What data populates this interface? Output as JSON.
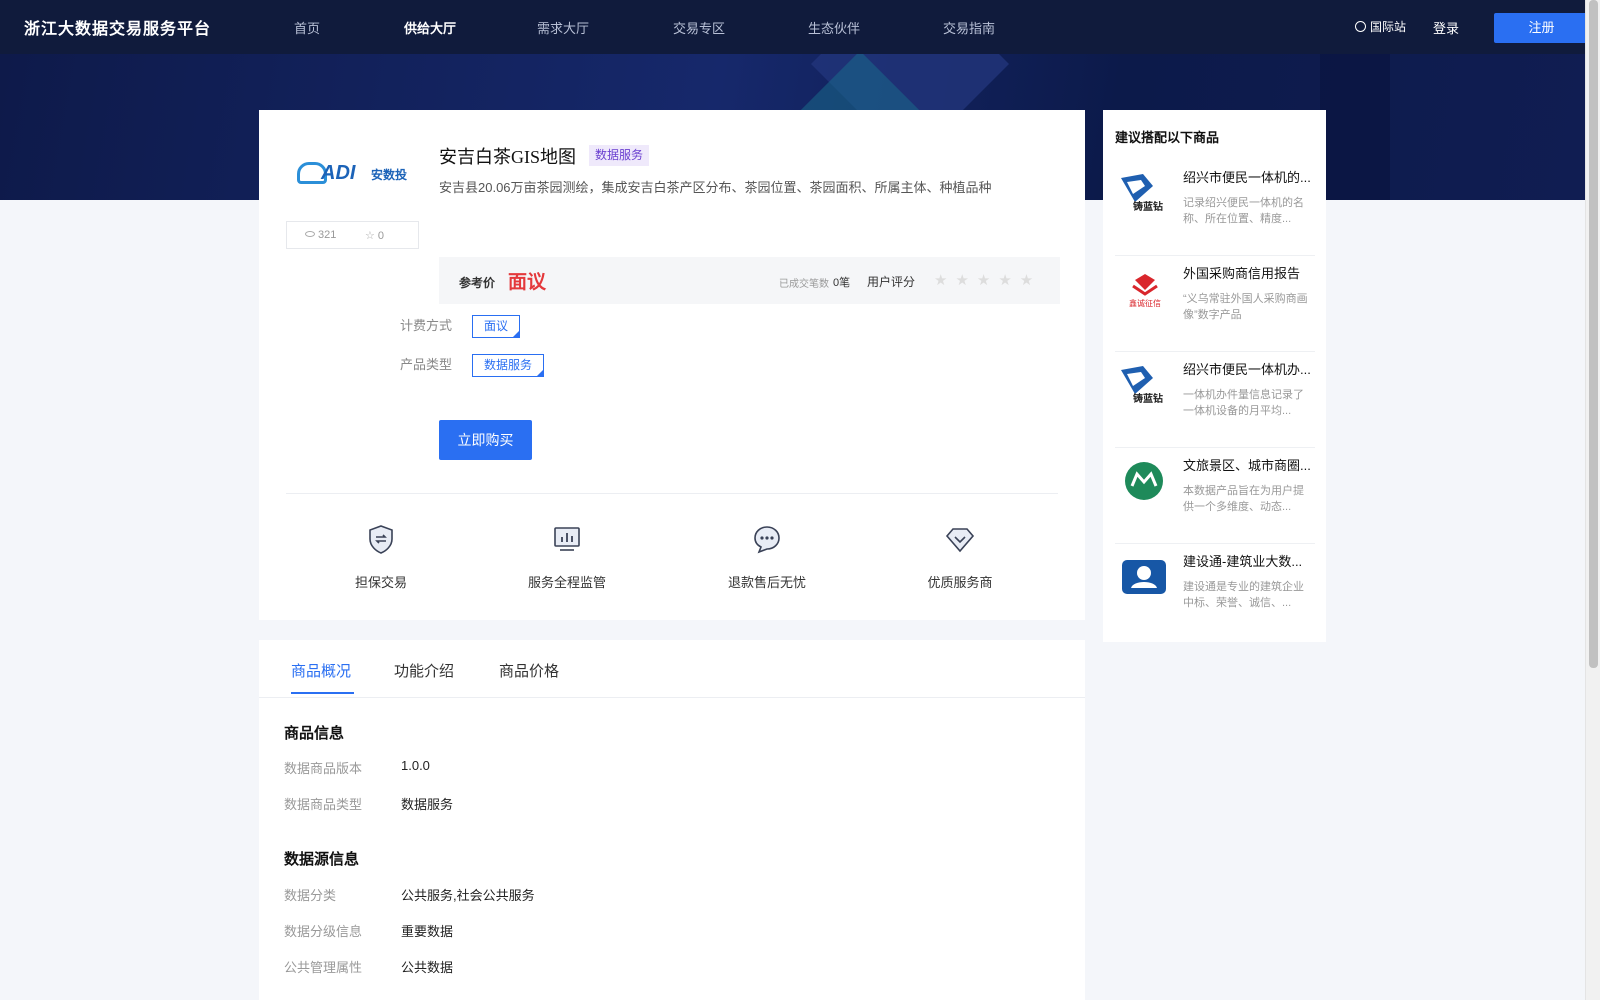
{
  "nav": {
    "brand": "浙江大数据交易服务平台",
    "links": [
      "首页",
      "供给大厅",
      "需求大厅",
      "交易专区",
      "生态伙伴",
      "交易指南"
    ],
    "intl": "国际站",
    "login": "登录",
    "register": "注册"
  },
  "product": {
    "logo_text": "ADI",
    "logo_cn": "安数投",
    "views": "321",
    "favorites": "0",
    "title": "安吉白茶GIS地图",
    "tag": "数据服务",
    "description": "安吉县20.06万亩茶园测绘，集成安吉白茶产区分布、茶园位置、茶园面积、所属主体、种植品种",
    "price_label": "参考价",
    "price_value": "面议",
    "deals_label": "已成交笔数",
    "deals_value": "0笔",
    "rating_label": "用户评分",
    "stars": "★★★★★",
    "billing_label": "计费方式",
    "billing_value": "面议",
    "type_label": "产品类型",
    "type_value": "数据服务",
    "buy_label": "立即购买"
  },
  "features": [
    "担保交易",
    "服务全程监管",
    "退款售后无忧",
    "优质服务商"
  ],
  "recommend": {
    "title": "建议搭配以下商品",
    "items": [
      {
        "name": "绍兴市便民一体机的...",
        "desc": "记录绍兴便民一体机的名称、所在位置、精度...",
        "logo": "铸蓝钻"
      },
      {
        "name": "外国采购商信用报告",
        "desc": "“义乌常驻外国人采购商画像”数字产品",
        "logo": "鑫诚征信"
      },
      {
        "name": "绍兴市便民一体机办...",
        "desc": "一体机办件量信息记录了一体机设备的月平均...",
        "logo": "铸蓝钻"
      },
      {
        "name": "文旅景区、城市商圈...",
        "desc": "本数据产品旨在为用户提供一个多维度、动态...",
        "logo": ""
      },
      {
        "name": "建设通-建筑业大数...",
        "desc": "建设通是专业的建筑企业中标、荣誉、诚信、...",
        "logo": ""
      }
    ]
  },
  "tabs": [
    "商品概况",
    "功能介绍",
    "商品价格"
  ],
  "product_info": {
    "title": "商品信息",
    "rows": [
      {
        "label": "数据商品版本",
        "value": "1.0.0"
      },
      {
        "label": "数据商品类型",
        "value": "数据服务"
      }
    ]
  },
  "source_info": {
    "title": "数据源信息",
    "rows": [
      {
        "label": "数据分类",
        "value": "公共服务,社会公共服务"
      },
      {
        "label": "数据分级信息",
        "value": "重要数据"
      },
      {
        "label": "公共管理属性",
        "value": "公共数据"
      }
    ]
  },
  "colors": {
    "accent": "#2a6ff2",
    "price": "#e4393c",
    "nav_bg": "#101b3c"
  }
}
